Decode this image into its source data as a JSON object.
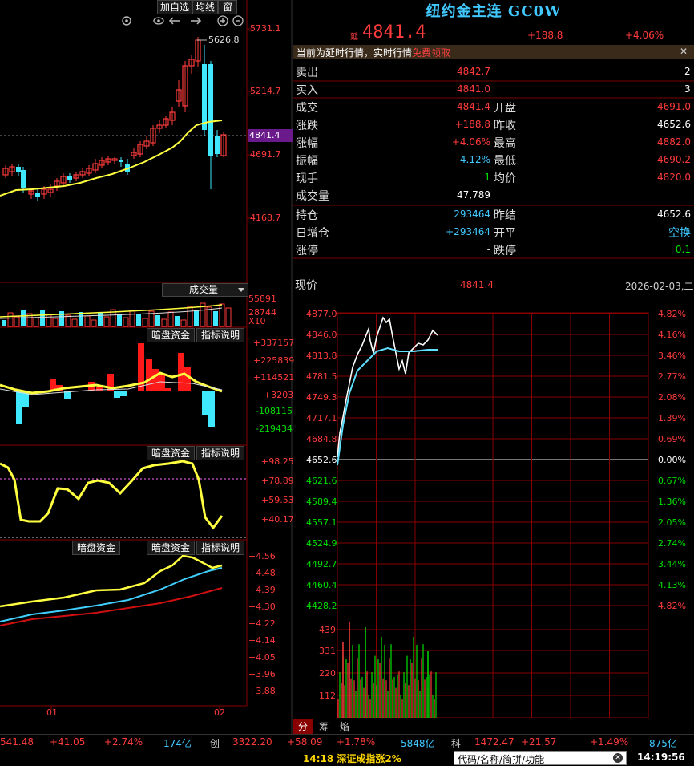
{
  "toolbar": {
    "add_fav": "加自选",
    "ma_line": "均线",
    "window": "窗"
  },
  "kline": {
    "prices": [
      "5731.1",
      "5214.7",
      "4841.4",
      "4691.7",
      "4168.7"
    ],
    "peak_label": "5626.8",
    "volume_label": "成交量",
    "vol_axis": [
      "55891",
      "28744",
      "X10"
    ],
    "date_labels": [
      "01",
      "02"
    ]
  },
  "ind1": {
    "btn1": "暗盘资金",
    "btn2": "指标说明",
    "axis": [
      "+337157",
      "+225839",
      "+114521",
      "+3203",
      "-108115",
      "-219434"
    ]
  },
  "ind2": {
    "btn1": "暗盘资金",
    "btn2": "指标说明",
    "axis": [
      "+98.25",
      "+78.89",
      "+59.53",
      "+40.17"
    ]
  },
  "ind3": {
    "btn0": "暗盘资金",
    "btn1": "暗盘资金",
    "btn2": "指标说明",
    "axis": [
      "+4.56",
      "+4.48",
      "+4.39",
      "+4.30",
      "+4.22",
      "+4.14",
      "+4.05",
      "+3.96",
      "+3.88"
    ]
  },
  "quote": {
    "title": "纽约金主连 GC0W",
    "delay_tag": "延",
    "last": "4841.4",
    "change": "+188.8",
    "pct": "+4.06%",
    "notice": "当前为延时行情，实时行情",
    "notice_link": "免费领取",
    "close_x": "✕",
    "sell_label": "卖出",
    "sell_price": "4842.7",
    "sell_qty": "2",
    "buy_label": "买入",
    "buy_price": "4841.0",
    "buy_qty": "3",
    "rows": [
      {
        "l": "成交",
        "v": "4841.4",
        "l2": "开盘",
        "v2": "4691.0"
      },
      {
        "l": "涨跌",
        "v": "+188.8",
        "l2": "昨收",
        "v2": "4652.6"
      },
      {
        "l": "涨幅",
        "v": "+4.06%",
        "l2": "最高",
        "v2": "4882.0"
      },
      {
        "l": "振幅",
        "v": "4.12%",
        "l2": "最低",
        "v2": "4690.2"
      },
      {
        "l": "现手",
        "v": "1",
        "l2": "均价",
        "v2": "4820.0"
      },
      {
        "l": "成交量",
        "v": "47,789",
        "l2": "",
        "v2": ""
      }
    ],
    "rows2": [
      {
        "l": "持仓",
        "v": "293464",
        "l2": "昨结",
        "v2": "4652.6"
      },
      {
        "l": "日增仓",
        "v": "+293464",
        "l2": "开平",
        "v2": "空换"
      },
      {
        "l": "涨停",
        "v": "-",
        "l2": "跌停",
        "v2": "0.1"
      }
    ]
  },
  "intraday": {
    "label": "现价",
    "price": "4841.4",
    "date": "2026-02-03,二",
    "left_axis": [
      "4877.0",
      "4846.0",
      "4813.8",
      "4781.5",
      "4749.3",
      "4717.1",
      "4684.8",
      "4652.6",
      "4621.6",
      "4589.4",
      "4557.1",
      "4524.9",
      "4492.7",
      "4460.4",
      "4428.2"
    ],
    "right_axis": [
      "4.82%",
      "4.16%",
      "3.46%",
      "2.77%",
      "2.08%",
      "1.39%",
      "0.69%",
      "0.00%",
      "0.67%",
      "1.36%",
      "2.05%",
      "2.74%",
      "3.44%",
      "4.13%",
      "4.82%"
    ],
    "vol_axis": [
      "439",
      "331",
      "220",
      "112"
    ],
    "tabs": [
      "分",
      "筹",
      "焰"
    ]
  },
  "ticker": {
    "items": [
      {
        "t": "541.48",
        "c": "red"
      },
      {
        "t": "+41.05",
        "c": "red"
      },
      {
        "t": "+2.74%",
        "c": "red"
      },
      {
        "t": "174亿",
        "c": "cyan"
      },
      {
        "t": "创",
        "c": "gray"
      },
      {
        "t": "3322.20",
        "c": "red"
      },
      {
        "t": "+58.09",
        "c": "red"
      },
      {
        "t": "+1.78%",
        "c": "red"
      },
      {
        "t": "5848亿",
        "c": "cyan"
      },
      {
        "t": "科",
        "c": "gray"
      },
      {
        "t": "1472.47",
        "c": "red"
      },
      {
        "t": "+21.57",
        "c": "red"
      },
      {
        "t": "+1.49%",
        "c": "red"
      },
      {
        "t": "875亿",
        "c": "cyan"
      }
    ],
    "news": "14:18 深证成指涨2%",
    "search_placeholder": "代码/名称/简拼/功能",
    "clock": "14:19:56"
  }
}
